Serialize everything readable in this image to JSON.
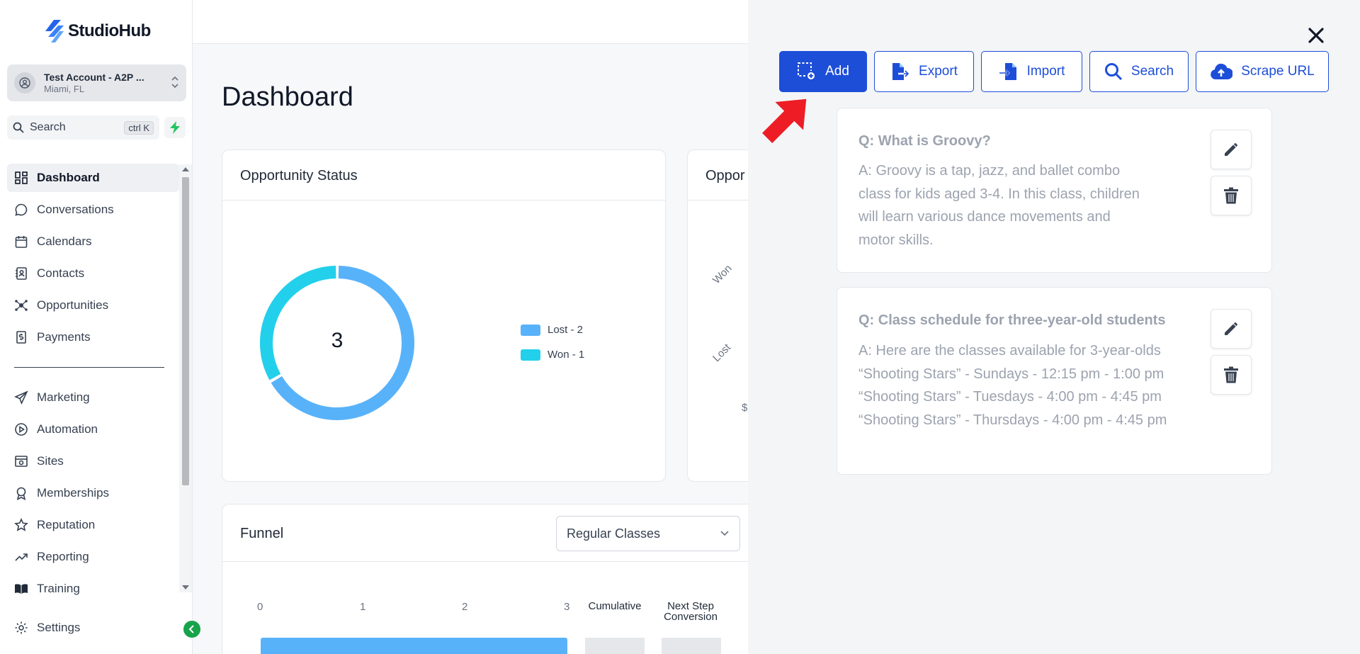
{
  "app": {
    "name": "StudioHub"
  },
  "account": {
    "name": "Test Account - A2P ...",
    "location": "Miami, FL"
  },
  "search": {
    "label": "Search",
    "shortcut": "ctrl K"
  },
  "nav": {
    "items": [
      {
        "label": "Dashboard",
        "icon": "dashboard-icon",
        "active": true
      },
      {
        "label": "Conversations",
        "icon": "chat-icon"
      },
      {
        "label": "Calendars",
        "icon": "calendar-icon"
      },
      {
        "label": "Contacts",
        "icon": "contacts-icon"
      },
      {
        "label": "Opportunities",
        "icon": "opportunities-icon"
      },
      {
        "label": "Payments",
        "icon": "payments-icon"
      },
      {
        "label": "Marketing",
        "icon": "send-icon"
      },
      {
        "label": "Automation",
        "icon": "automation-icon"
      },
      {
        "label": "Sites",
        "icon": "sites-icon"
      },
      {
        "label": "Memberships",
        "icon": "award-icon"
      },
      {
        "label": "Reputation",
        "icon": "star-icon"
      },
      {
        "label": "Reporting",
        "icon": "trend-icon"
      },
      {
        "label": "Training",
        "icon": "book-icon"
      }
    ],
    "settings": "Settings"
  },
  "main": {
    "title": "Dashboard",
    "opportunity_status": {
      "title": "Opportunity Status",
      "center_value": "3",
      "legend": [
        "Lost - 2",
        "Won - 1"
      ]
    },
    "opportunity_card": {
      "title": "Oppor",
      "labels": [
        "Won",
        "Lost",
        "$"
      ]
    },
    "funnel": {
      "title": "Funnel",
      "select_value": "Regular Classes",
      "ticks": [
        "0",
        "1",
        "2",
        "3"
      ],
      "columns": [
        "Cumulative",
        "Next Step Conversion"
      ]
    }
  },
  "chart_data": {
    "type": "pie",
    "categories": [
      "Lost",
      "Won"
    ],
    "values": [
      2,
      1
    ],
    "legend": [
      "Lost - 2",
      "Won - 1"
    ],
    "colors": [
      "#58b2fa",
      "#22d0eb"
    ],
    "center_label": "3",
    "legend_position": "right"
  },
  "panel": {
    "buttons": {
      "add": "Add",
      "export": "Export",
      "import": "Import",
      "search": "Search",
      "scrape": "Scrape URL"
    },
    "qa": [
      {
        "q": "Q: What is Groovy?",
        "a": "A: Groovy is a tap, jazz, and ballet combo class for kids aged 3-4. In this class, children will learn various dance movements and motor skills."
      },
      {
        "q": "Q: Class schedule for three-year-old students",
        "a": "A: Here are the classes available for 3-year-olds “Shooting Stars” - Sundays - 12:15 pm - 1:00 pm “Shooting Stars” - Tuesdays - 4:00 pm - 4:45 pm “Shooting Stars” - Thursdays - 4:00 pm - 4:45 pm"
      }
    ]
  },
  "colors": {
    "primary": "#1d4ed8",
    "lost": "#58b2fa",
    "won": "#22d0eb",
    "annotation_arrow": "#ee1c25"
  }
}
